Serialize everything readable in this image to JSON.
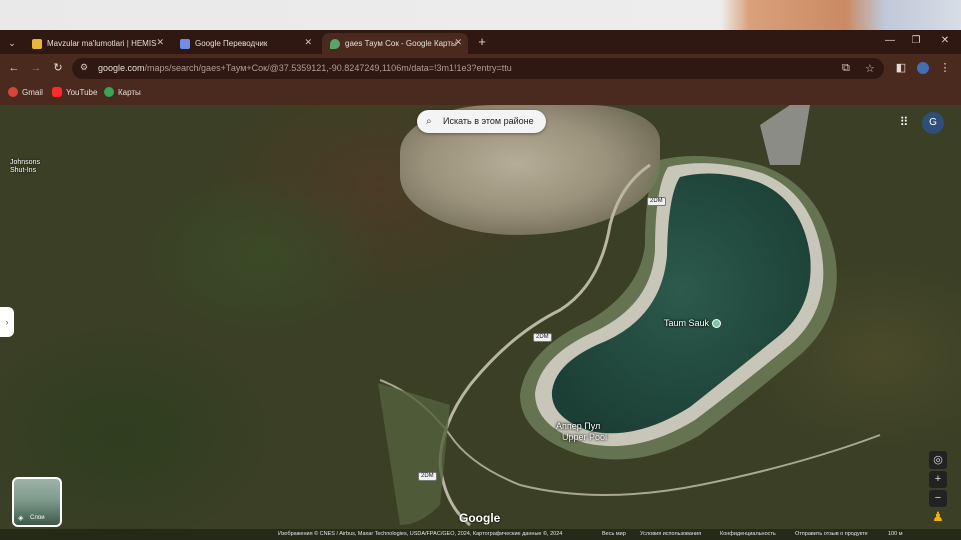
{
  "browser": {
    "tabs": [
      {
        "title": "Mavzular ma'lumotlari | HEMIS",
        "fav_color": "#e8b73a"
      },
      {
        "title": "Google Переводчик",
        "fav_color": "#6d8fe8"
      },
      {
        "title": "gaes Таум Сок - Google Карты",
        "fav_color": "#5aa469",
        "active": true
      }
    ],
    "url_host": "google.com",
    "url_path": "/maps/search/gaes+Таум+Сок/@37.5359121,-90.8247249,1106m/data=!3m1!1e3?entry=ttu",
    "bookmarks": [
      {
        "label": "Gmail",
        "color": "#d44638"
      },
      {
        "label": "YouTube",
        "color": "#ff2a2a"
      },
      {
        "label": "Карты",
        "color": "#34a853"
      }
    ]
  },
  "map": {
    "search_area_label": "Искать в этом районе",
    "avatar_letter": "G",
    "place_label": "Johnsons\nShut-Ins",
    "reservoir_label": "Taum Sauk",
    "upper_pool_label_ru": "Аппер Пул",
    "upper_pool_label_en": "Upper Pool",
    "road_labels": [
      "2DM",
      "2DM",
      "2DM"
    ],
    "layers_label": "Слои",
    "google_logo": "Google",
    "attribution": {
      "imagery": "Изображения © CNES / Airbus, Maxar Technologies, USDA/FPAC/GEO, 2024, Картографические данные ©, 2024",
      "terms": "Весь мир",
      "privacy": "Условия использования",
      "confidential": "Конфиденциальность",
      "feedback": "Отправить отзыв о продукте",
      "scale": "100 м"
    }
  }
}
